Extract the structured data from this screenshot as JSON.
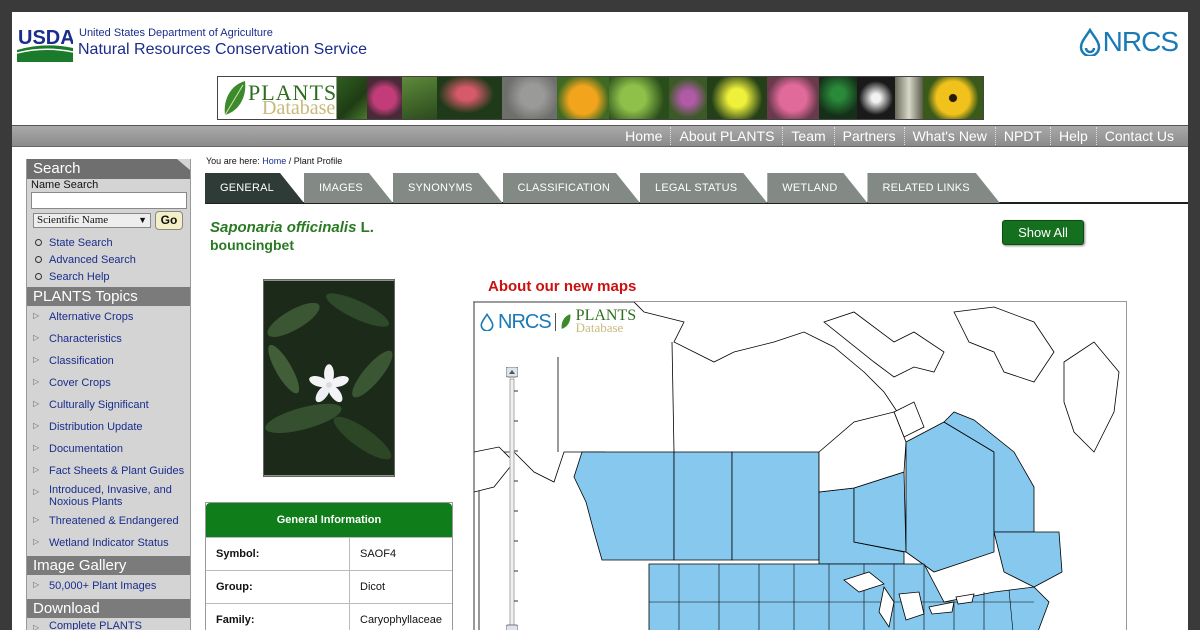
{
  "header": {
    "agency_abbr": "USDA",
    "agency_name": "United States Department of Agriculture",
    "service_name": "Natural Resources Conservation Service",
    "service_logo": "NRCS",
    "banner_logo_line1": "PLANTS",
    "banner_logo_line2": "Database"
  },
  "topnav": [
    "Home",
    "About PLANTS",
    "Team",
    "Partners",
    "What's New",
    "NPDT",
    "Help",
    "Contact Us"
  ],
  "sidebar": {
    "search_heading": "Search",
    "name_search_label": "Name Search",
    "name_search_value": "",
    "search_type_selected": "Scientific Name",
    "go_label": "Go",
    "search_links": [
      "State Search",
      "Advanced Search",
      "Search Help"
    ],
    "topics_heading": "PLANTS Topics",
    "topics": [
      "Alternative Crops",
      "Characteristics",
      "Classification",
      "Cover Crops",
      "Culturally Significant",
      "Distribution Update",
      "Documentation",
      "Fact Sheets & Plant Guides",
      "Introduced, Invasive, and Noxious Plants",
      "Threatened & Endangered",
      "Wetland Indicator Status"
    ],
    "gallery_heading": "Image Gallery",
    "gallery_links": [
      "50,000+ Plant Images"
    ],
    "download_heading": "Download",
    "download_links": [
      "Complete PLANTS Checklist"
    ]
  },
  "breadcrumb": {
    "prefix": "You are here: ",
    "home": "Home",
    "separator": " / ",
    "current": "Plant Profile"
  },
  "tabs": [
    "GENERAL",
    "IMAGES",
    "SYNONYMS",
    "CLASSIFICATION",
    "LEGAL STATUS",
    "WETLAND",
    "RELATED LINKS"
  ],
  "active_tab": "GENERAL",
  "profile": {
    "scientific_name": "Saponaria officinalis",
    "author": "L.",
    "common_name": "bouncingbet",
    "show_all_label": "Show All"
  },
  "general_info": {
    "title": "General Information",
    "rows": [
      {
        "key": "Symbol:",
        "value": "SAOF4"
      },
      {
        "key": "Group:",
        "value": "Dicot"
      },
      {
        "key": "Family:",
        "value": "Caryophyllaceae"
      }
    ]
  },
  "map": {
    "link_text": "About our new maps",
    "logo_left": "NRCS",
    "logo_right_1": "PLANTS",
    "logo_right_2": "Database"
  },
  "colors": {
    "accent_green": "#0e7d1a",
    "text_green": "#2a7a24",
    "link_blue": "#1a2d8c",
    "map_fill": "#87c9ee",
    "alert_red": "#cc1010"
  }
}
